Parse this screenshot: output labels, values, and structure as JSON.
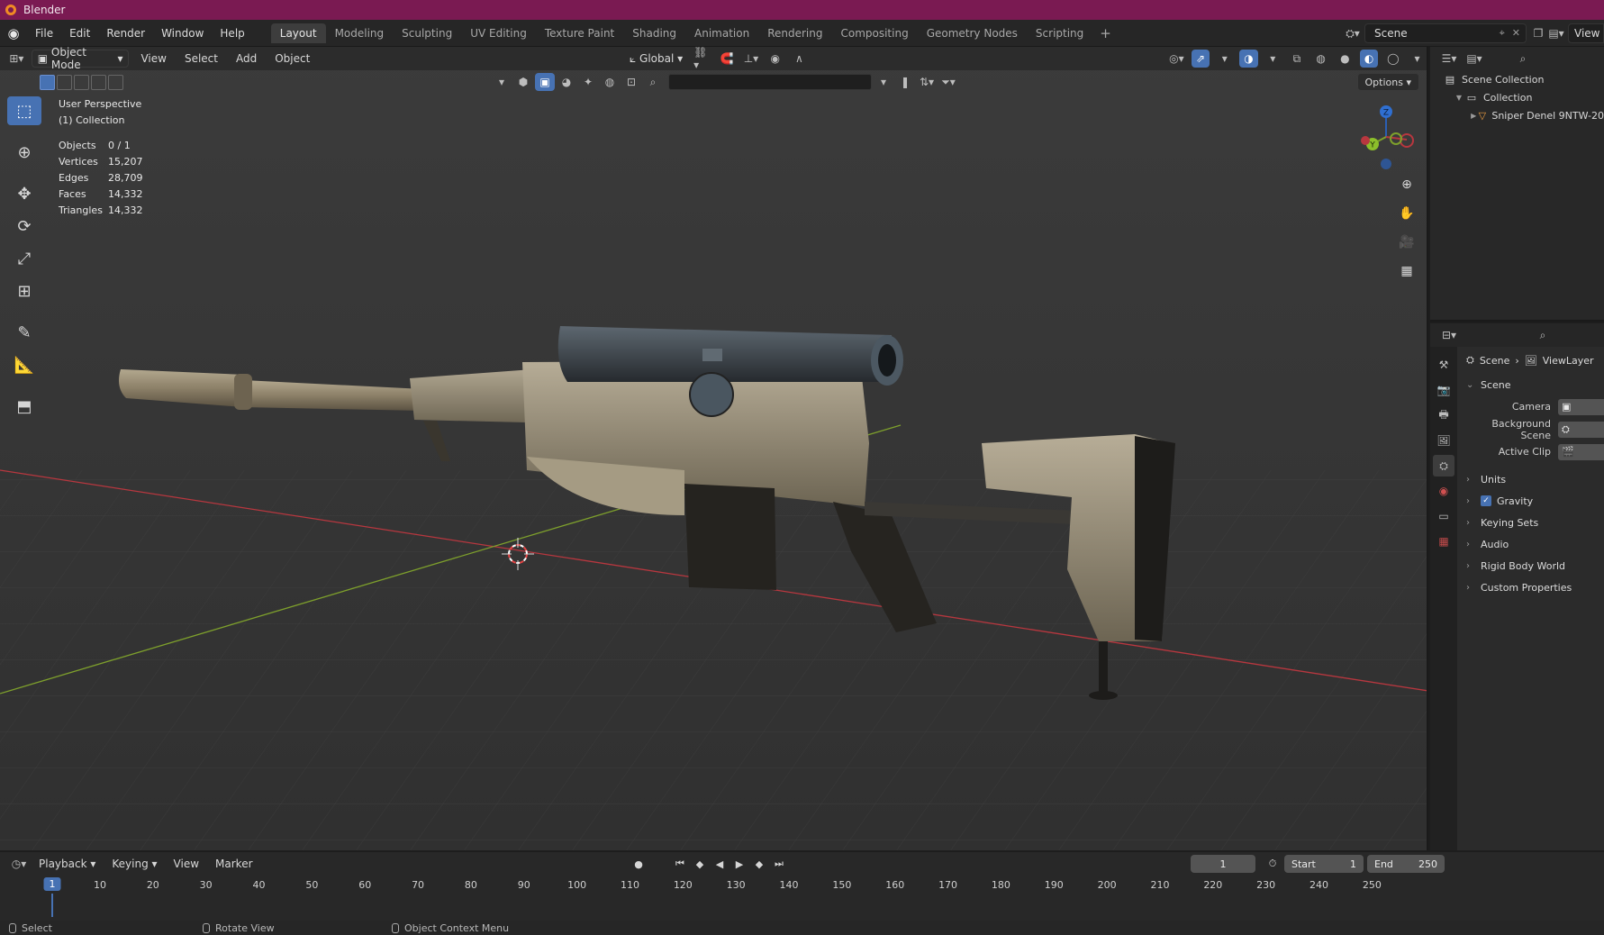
{
  "window": {
    "title": "Blender"
  },
  "menubar": {
    "items": [
      "File",
      "Edit",
      "Render",
      "Window",
      "Help"
    ],
    "workspaces": [
      "Layout",
      "Modeling",
      "Sculpting",
      "UV Editing",
      "Texture Paint",
      "Shading",
      "Animation",
      "Rendering",
      "Compositing",
      "Geometry Nodes",
      "Scripting"
    ],
    "active_workspace": "Layout",
    "scene_name": "Scene",
    "view_layer": "View"
  },
  "viewport": {
    "mode": "Object Mode",
    "menus": [
      "View",
      "Select",
      "Add",
      "Object"
    ],
    "transform_orientation": "Global",
    "options_label": "Options",
    "view_name": "User Perspective",
    "collection_label": "(1) Collection",
    "stats": [
      {
        "key": "Objects",
        "value": "0 / 1"
      },
      {
        "key": "Vertices",
        "value": "15,207"
      },
      {
        "key": "Edges",
        "value": "28,709"
      },
      {
        "key": "Faces",
        "value": "14,332"
      },
      {
        "key": "Triangles",
        "value": "14,332"
      }
    ],
    "gizmo": {
      "z": "Z",
      "y": "Y"
    }
  },
  "outliner": {
    "rows": [
      "Scene Collection",
      "Collection",
      "Sniper Denel 9NTW-20"
    ]
  },
  "properties": {
    "breadcrumb": {
      "scene": "Scene",
      "view_layer": "ViewLayer"
    },
    "scene_panel": "Scene",
    "fields": [
      {
        "label": "Camera"
      },
      {
        "label": "Background Scene"
      },
      {
        "label": "Active Clip"
      }
    ],
    "subpanels": [
      "Units",
      "Gravity",
      "Keying Sets",
      "Audio",
      "Rigid Body World",
      "Custom Properties"
    ],
    "gravity_checked": true
  },
  "timeline": {
    "menus": [
      "Playback",
      "Keying",
      "View",
      "Marker"
    ],
    "current_frame": "1",
    "start_label": "Start",
    "start_value": "1",
    "end_label": "End",
    "end_value": "250",
    "ticks": [
      "1",
      "10",
      "20",
      "30",
      "40",
      "50",
      "60",
      "70",
      "80",
      "90",
      "100",
      "110",
      "120",
      "130",
      "140",
      "150",
      "160",
      "170",
      "180",
      "190",
      "200",
      "210",
      "220",
      "230",
      "240",
      "250"
    ]
  },
  "statusbar": {
    "items": [
      "Select",
      "Rotate View",
      "Object Context Menu"
    ]
  },
  "colors": {
    "title_bar": "#7a1a52",
    "accent": "#4772b3",
    "x_axis": "#b8373f",
    "y_axis": "#7ea02c"
  }
}
